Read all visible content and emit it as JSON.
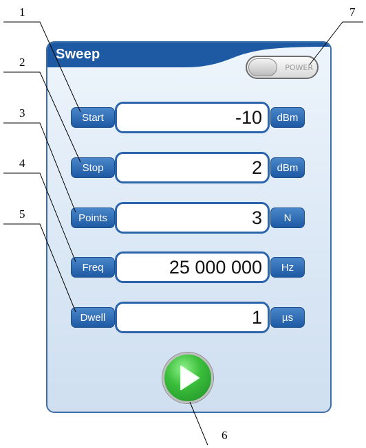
{
  "panel": {
    "title": "Sweep"
  },
  "power": {
    "label": "POWER"
  },
  "rows": [
    {
      "label": "Start",
      "value": "-10",
      "unit": "dBm"
    },
    {
      "label": "Stop",
      "value": "2",
      "unit": "dBm"
    },
    {
      "label": "Points",
      "value": "3",
      "unit": "N"
    },
    {
      "label": "Freq",
      "value": "25 000 000",
      "unit": "Hz"
    },
    {
      "label": "Dwell",
      "value": "1",
      "unit": "µs"
    }
  ],
  "callouts": [
    "1",
    "2",
    "3",
    "4",
    "5",
    "6",
    "7"
  ],
  "colors": {
    "panel_border": "#3d6fa6",
    "accent": "#2b64ab",
    "play_green": "#3cbf3c"
  },
  "icons": {
    "run": "play-icon",
    "power": "toggle-switch"
  }
}
